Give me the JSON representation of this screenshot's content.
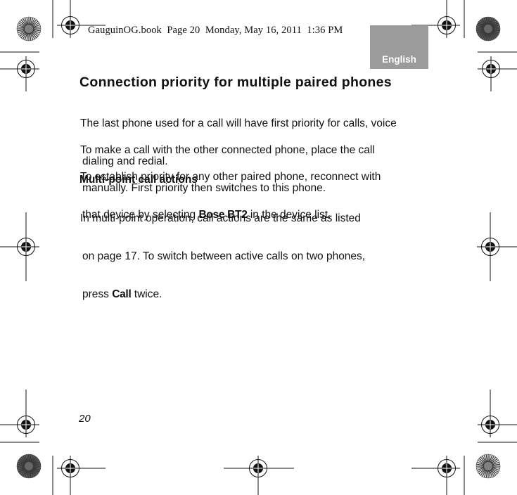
{
  "header": {
    "slug": "GauguinOG.book  Page 20  Monday, May 16, 2011  1:36 PM",
    "language_tab": "English"
  },
  "section": {
    "title": "Connection priority for multiple paired phones",
    "paragraphs": [
      {
        "line1": "The last phone used for a call will have first priority for calls, voice",
        "line2": "dialing and redial."
      },
      {
        "line1": "To make a call with the other connected phone, place the call",
        "line2": "manually. First priority then switches to this phone."
      },
      {
        "line1": "To establish priority for any other paired phone, reconnect with",
        "line2_before": "that device by selecting ",
        "line2_bold": "Bose BT2",
        "line2_after": " in the device list."
      }
    ]
  },
  "subsection": {
    "title": "Multi-point call actions",
    "line1": "In multi-point operation, call actions are the same as listed",
    "line2": "on page 17. To switch between active calls on two phones,",
    "line3_before": "press ",
    "line3_bold": "Call",
    "line3_after": " twice."
  },
  "footer": {
    "page_number": "20"
  },
  "print_marks": {
    "icons": [
      "registration-mark-icon",
      "color-bar-starburst-icon",
      "crop-mark-icon"
    ]
  }
}
